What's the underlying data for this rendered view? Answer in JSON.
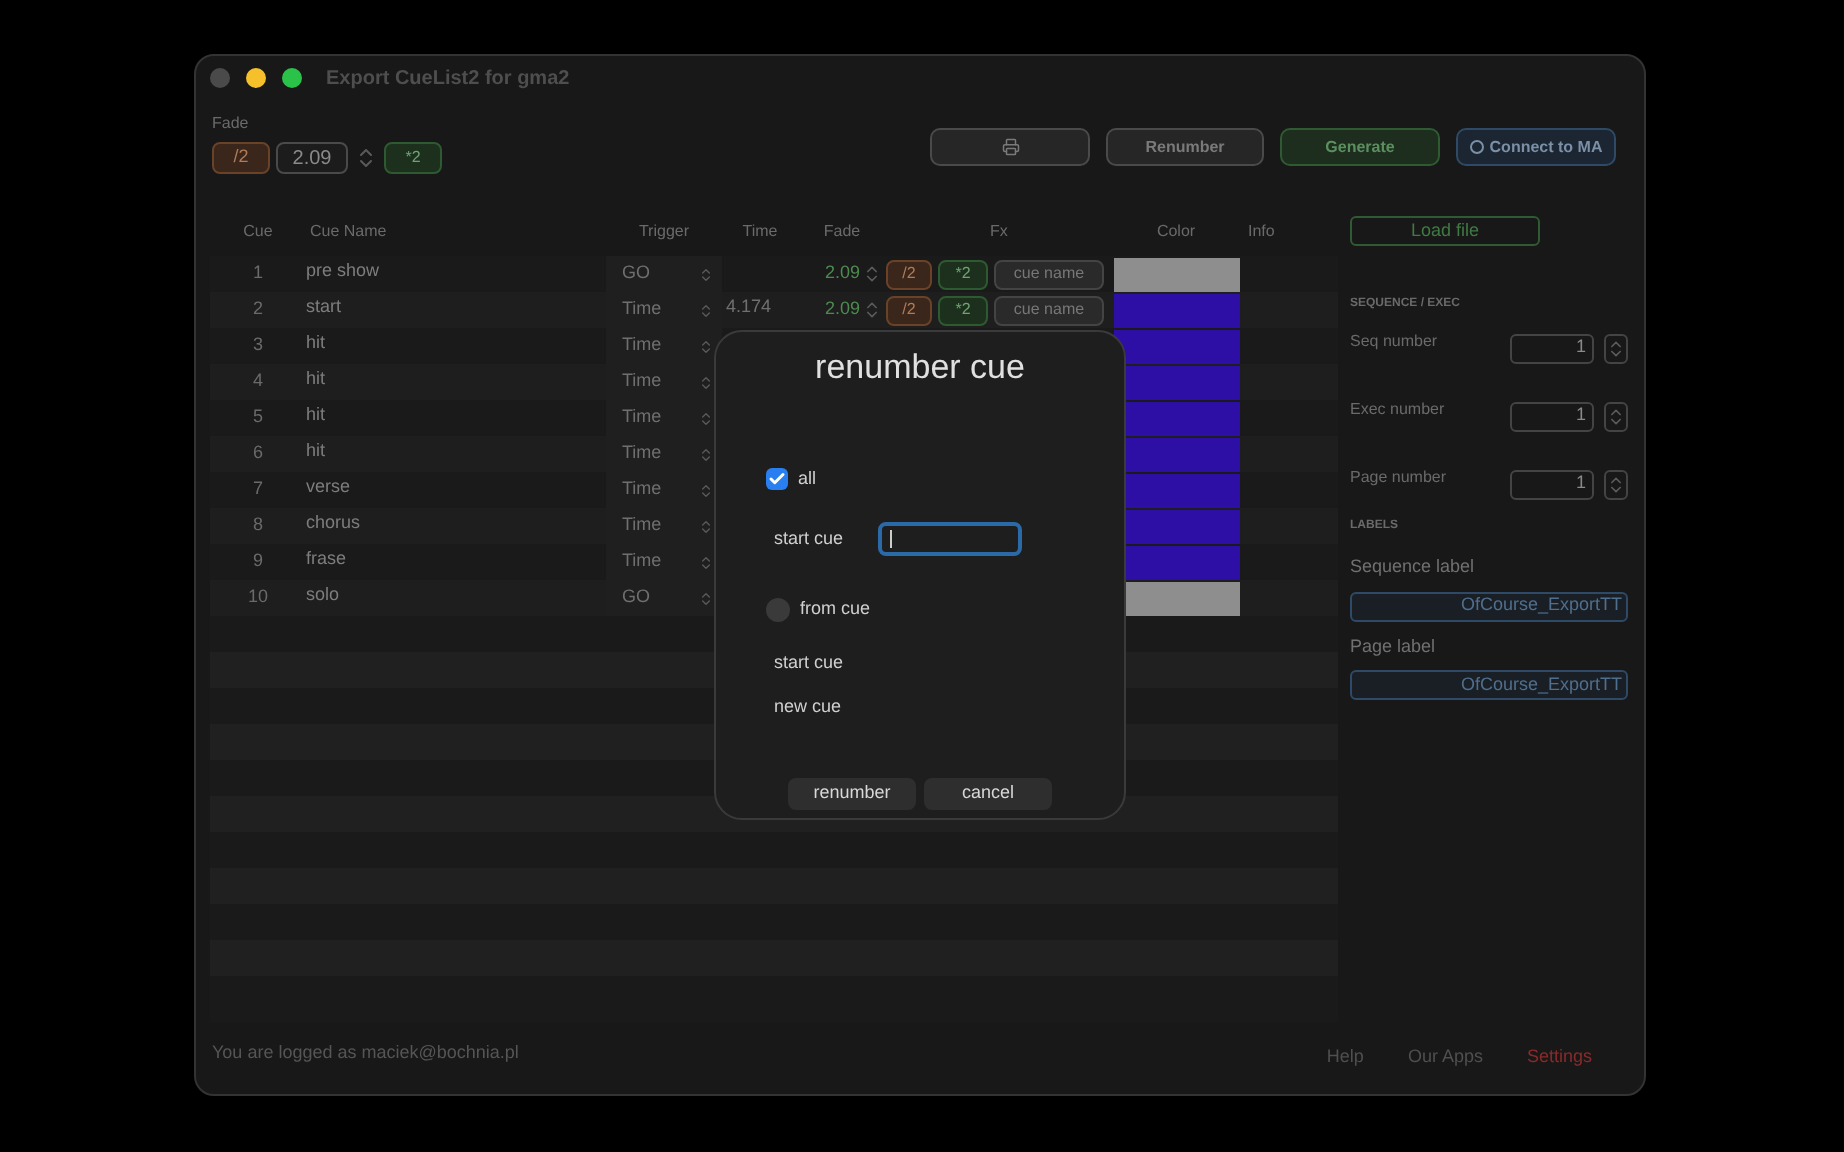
{
  "window": {
    "title": "Export CueList2 for gma2"
  },
  "fade_control": {
    "label": "Fade",
    "halve": "/2",
    "value": "2.09",
    "double": "*2"
  },
  "toolbar": [
    {
      "kind": "print"
    },
    {
      "kind": "plain",
      "label": "Renumber"
    },
    {
      "kind": "generate",
      "label": "Generate"
    },
    {
      "kind": "connect",
      "label": "Connect to MA"
    }
  ],
  "table": {
    "columns": [
      "Cue",
      "Cue Name",
      "Trigger",
      "Time",
      "Fade",
      "Fx",
      "Color",
      "Info"
    ],
    "rows": [
      {
        "cue": "1",
        "name": "pre show",
        "trigger": "GO",
        "fade": "2.09",
        "fx": {
          "halve": "/2",
          "double": "*2",
          "name": "cue name"
        },
        "color": "#8e8e8e"
      },
      {
        "cue": "2",
        "name": "start",
        "trigger": "Time",
        "time": "4.174",
        "fade": "2.09",
        "fx": {
          "halve": "/2",
          "double": "*2",
          "name": "cue name"
        },
        "color": "#2e0fa6"
      },
      {
        "cue": "3",
        "name": "hit",
        "trigger": "Time",
        "color": "#2e0fa6"
      },
      {
        "cue": "4",
        "name": "hit",
        "trigger": "Time",
        "color": "#2e0fa6"
      },
      {
        "cue": "5",
        "name": "hit",
        "trigger": "Time",
        "color": "#2e0fa6"
      },
      {
        "cue": "6",
        "name": "hit",
        "trigger": "Time",
        "color": "#2e0fa6"
      },
      {
        "cue": "7",
        "name": "verse",
        "trigger": "Time",
        "color": "#2e0fa6"
      },
      {
        "cue": "8",
        "name": "chorus",
        "trigger": "Time",
        "color": "#2e0fa6"
      },
      {
        "cue": "9",
        "name": "frase",
        "trigger": "Time",
        "color": "#2e0fa6"
      },
      {
        "cue": "10",
        "name": "solo",
        "trigger": "GO",
        "color": "#8e8e8e"
      }
    ]
  },
  "side": {
    "load_file": "Load file",
    "sequence_heading": "SEQUENCE / EXEC",
    "numbers": [
      {
        "label": "Seq number",
        "value": "1"
      },
      {
        "label": "Exec number",
        "value": "1"
      },
      {
        "label": "Page number",
        "value": "1"
      }
    ],
    "labels_heading": "LABELS",
    "labels": [
      {
        "label": "Sequence label",
        "value": "OfCourse_ExportTT"
      },
      {
        "label": "Page label",
        "value": "OfCourse_ExportTT"
      }
    ]
  },
  "dialog": {
    "title": "renumber cue",
    "all": {
      "label": "all",
      "checked": true
    },
    "start_cue": {
      "label": "start cue",
      "focused": true
    },
    "from_cue": {
      "label": "from cue",
      "selected": false
    },
    "from_labels": [
      "start cue",
      "new cue"
    ],
    "buttons": [
      "renumber",
      "cancel"
    ]
  },
  "footer": {
    "login": "You are logged as maciek@bochnia.pl",
    "links": [
      {
        "label": "Help",
        "kind": "plain"
      },
      {
        "label": "Our Apps",
        "kind": "plain"
      },
      {
        "label": "Settings",
        "kind": "accent"
      }
    ]
  }
}
